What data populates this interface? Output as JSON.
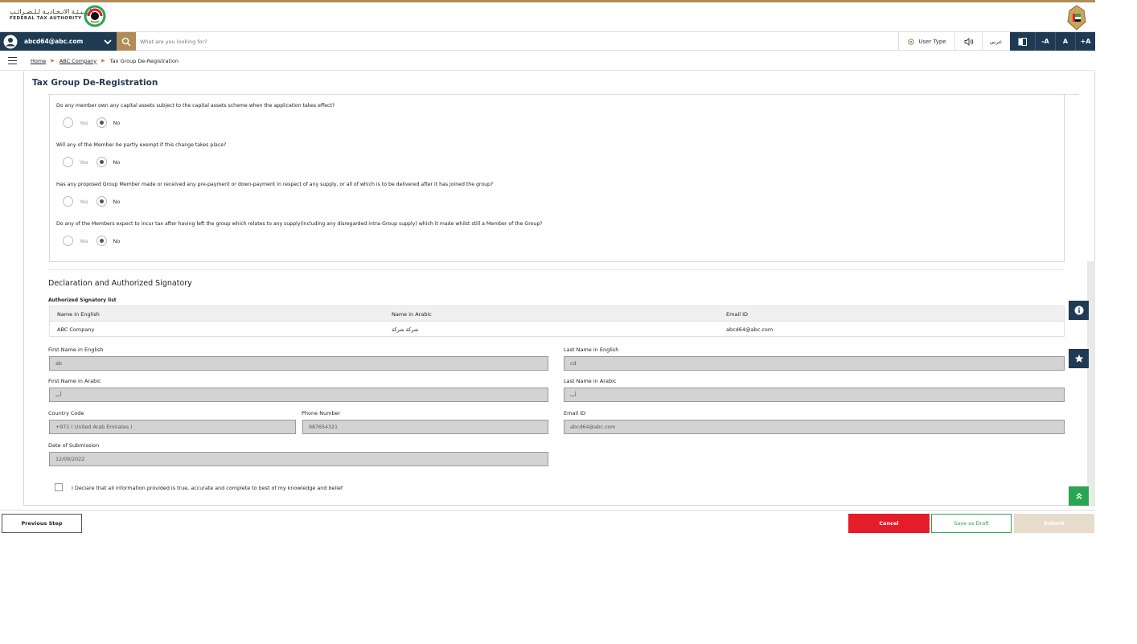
{
  "brand": {
    "logo_ar": "الـهـيـئـة الاتـحـاديـة لـلـضـرائـب",
    "logo_en": "FEDERAL TAX AUTHORITY",
    "logo_icon": "fta-logo-mark",
    "emblem_icon": "uae-emblem"
  },
  "topbar": {
    "user_email": "abcd64@abc.com",
    "search_placeholder": "What are you looking for?",
    "user_type_label": "User Type",
    "arabic_label": "عربي",
    "font_decrease": "-A",
    "font_default": "A",
    "font_increase": "+A"
  },
  "breadcrumb": {
    "home": "Home",
    "company": "ABC Company",
    "current": "Tax Group De-Registration"
  },
  "page": {
    "title": "Tax Group De-Registration"
  },
  "questions": [
    {
      "text": "Do any member own any capital assets subject to the capital assets scheme when the application takes effect?",
      "yes": "Yes",
      "no": "No",
      "selected": "No"
    },
    {
      "text": "Will any of the Member be partly exempt if this change takes place?",
      "yes": "Yes",
      "no": "No",
      "selected": "No"
    },
    {
      "text": "Has any proposed Group Member made or received any pre-payment or down-payment in respect of any supply, or all of which is to be delivered after it has joined the group?",
      "yes": "Yes",
      "no": "No",
      "selected": "No"
    },
    {
      "text": "Do any of the Members expect to incur tax after having left the group which relates to any supply(including any disregarded intra-Group supply) which it made whilst still a Member of the Group?",
      "yes": "Yes",
      "no": "No",
      "selected": "No"
    }
  ],
  "declaration": {
    "title": "Declaration and Authorized Signatory",
    "list_label": "Authorized Signatory list",
    "columns": [
      "Name in English",
      "Name in Arabic",
      "Email ID"
    ],
    "rows": [
      [
        "ABC Company",
        "شركة شركة",
        "abcd64@abc.com"
      ]
    ],
    "first_name_en_label": "First Name in English",
    "first_name_en": "ab",
    "last_name_en_label": "Last Name in English",
    "last_name_en": "cd",
    "first_name_ar_label": "First Name in Arabic",
    "first_name_ar": "أب",
    "last_name_ar_label": "Last Name in Arabic",
    "last_name_ar": "أب",
    "country_code_label": "Country Code",
    "country_code": "+971 ( United Arab Emirates )",
    "phone_label": "Phone Number",
    "phone": "987654321",
    "email_label": "Email ID",
    "email": "abcd64@abc.com",
    "date_label": "Date of Submission",
    "date": "12/09/2022",
    "checkbox_text": "I Declare that all information provided is true, accurate and complete to best of my knowledge and belief"
  },
  "actions": {
    "previous": "Previous Step",
    "cancel": "Cancel",
    "save_draft": "Save as Draft",
    "submit": "Submit"
  },
  "colors": {
    "navy": "#1f3a53",
    "gold": "#b08d57",
    "red": "#e51c2a",
    "green": "#2aa552",
    "submit_disabled": "#e8dccd"
  }
}
